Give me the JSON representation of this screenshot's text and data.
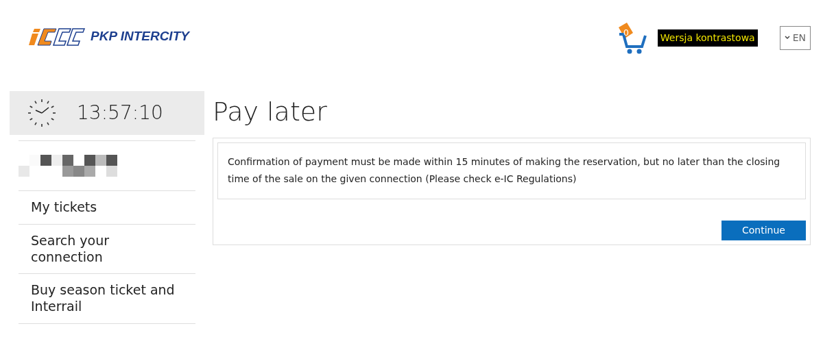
{
  "header": {
    "logo_text": "PKP INTERCITY",
    "cart_count": "0",
    "contrast_link": "Wersja kontrastowa",
    "language": "EN"
  },
  "sidebar": {
    "clock": "13:57:10",
    "items": [
      {
        "label": "My tickets"
      },
      {
        "label": "Search your connection"
      },
      {
        "label": "Buy season ticket and Interrail"
      }
    ]
  },
  "main": {
    "title": "Pay later",
    "message": "Confirmation of payment must be made within 15 minutes of making the reservation, but no later than the closing time of the sale on the given connection (Please check e-IC Regulations)",
    "button": "Continue"
  }
}
